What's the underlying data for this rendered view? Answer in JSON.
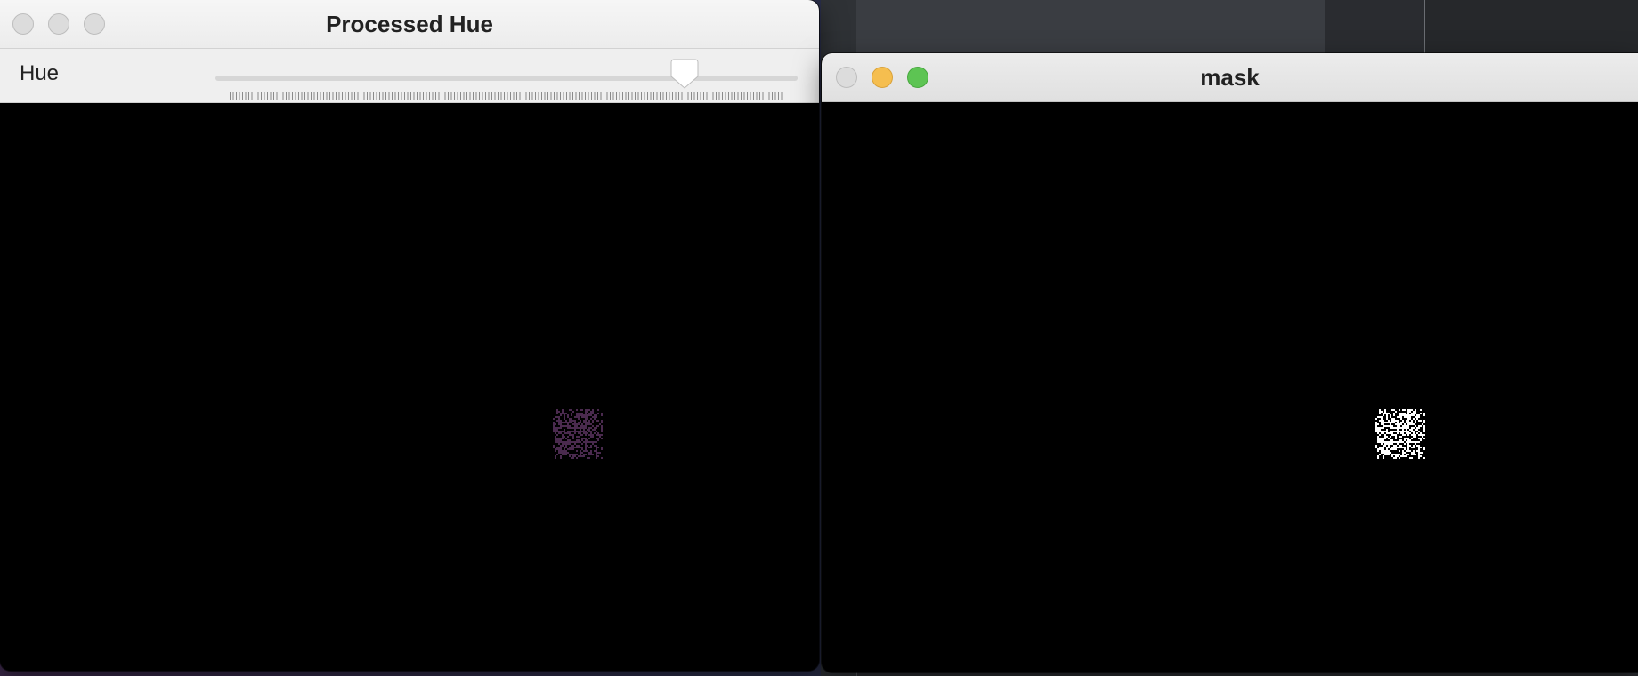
{
  "windows": {
    "hue": {
      "title": "Processed Hue",
      "trackbar": {
        "label": "Hue",
        "value_fraction": 0.81
      },
      "blob_color": "#4a2a4e"
    },
    "mask": {
      "title": "mask",
      "blob_color": "#ffffff"
    }
  },
  "colors": {
    "traffic_close": "#dcdcdc",
    "traffic_minimize": "#f5be4f",
    "traffic_zoom": "#5dc453"
  },
  "icons": [
    "close-button-icon",
    "minimize-button-icon",
    "zoom-button-icon",
    "slider-thumb-icon"
  ]
}
